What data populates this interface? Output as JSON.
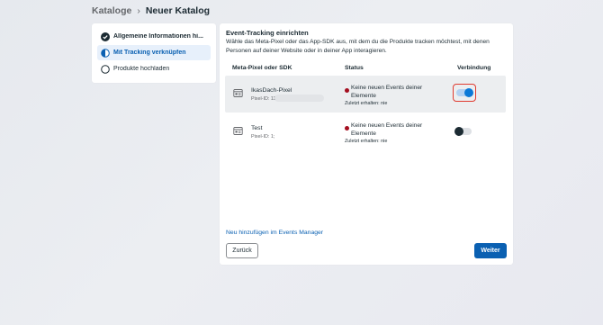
{
  "breadcrumb": {
    "parent": "Kataloge",
    "separator": "›",
    "current": "Neuer Katalog"
  },
  "steps": [
    {
      "label": "Allgemeine Informationen hi...",
      "state": "done"
    },
    {
      "label": "Mit Tracking verknüpfen",
      "state": "active"
    },
    {
      "label": "Produkte hochladen",
      "state": "todo"
    }
  ],
  "panel": {
    "title": "Event-Tracking einrichten",
    "description": "Wähle das Meta-Pixel oder das App-SDK aus, mit dem du die Produkte tracken möchtest, mit denen Personen auf deiner Website oder in deiner App interagieren.",
    "columns": {
      "name": "Meta-Pixel oder SDK",
      "status": "Status",
      "connection": "Verbindung"
    },
    "rows": [
      {
        "name": "IkasDach-Pixel",
        "pixel_id": "Pixel-ID: 11",
        "status": "Keine neuen Events deiner Elemente",
        "last_received": "Zuletzt erhalten: nie",
        "connected": true
      },
      {
        "name": "Test",
        "pixel_id": "Pixel-ID: 1;",
        "status": "Keine neuen Events deiner Elemente",
        "last_received": "Zuletzt erhalten: nie",
        "connected": false
      }
    ],
    "add_link": "Neu hinzufügen im Events Manager",
    "back_label": "Zurück",
    "next_label": "Weiter"
  },
  "colors": {
    "accent": "#0a60b2",
    "status_error": "#a40e1f",
    "highlight": "#e03c31"
  }
}
